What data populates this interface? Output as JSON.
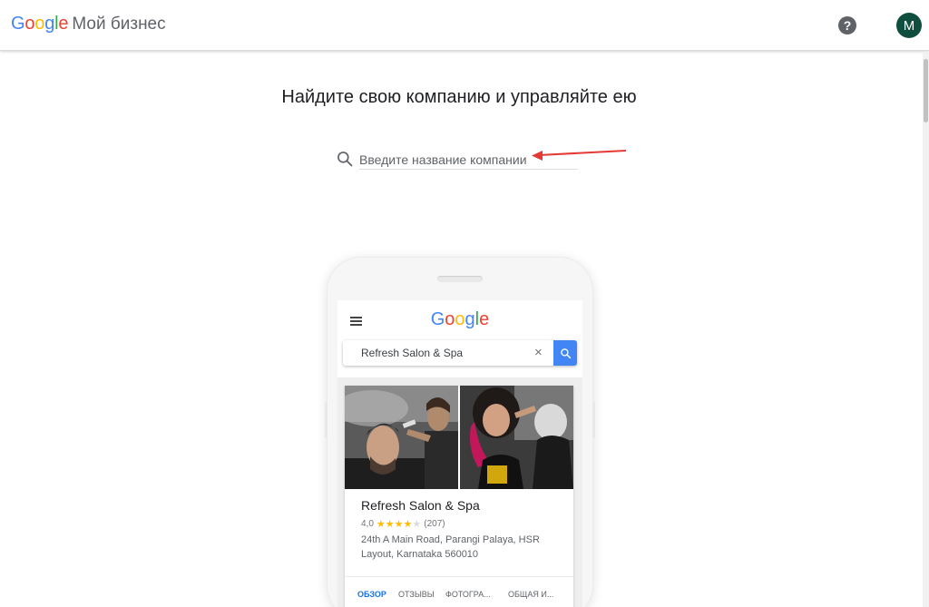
{
  "header": {
    "logo_letters": [
      {
        "ch": "G",
        "color": "#4285F4"
      },
      {
        "ch": "o",
        "color": "#EA4335"
      },
      {
        "ch": "o",
        "color": "#FBBC05"
      },
      {
        "ch": "g",
        "color": "#4285F4"
      },
      {
        "ch": "l",
        "color": "#34A853"
      },
      {
        "ch": "e",
        "color": "#EA4335"
      }
    ],
    "product_name": "Мой бизнес",
    "help_icon": "?",
    "avatar_letter": "M",
    "avatar_color": "#0f4e3f"
  },
  "main": {
    "heading": "Найдите свою компанию и управляйте ею",
    "search": {
      "placeholder": "Введите название компании",
      "value": ""
    },
    "annotation_arrow_color": "#e53935"
  },
  "phone": {
    "logo": "Google",
    "search_query": "Refresh Salon & Spa",
    "clear_symbol": "×",
    "card": {
      "title": "Refresh Salon & Spa",
      "rating_value": "4,0",
      "stars_filled": "★★★★",
      "stars_empty": "★",
      "review_count": "(207)",
      "address": "24th A Main Road, Parangi Palaya, HSR Layout, Karnataka 560010",
      "tabs": [
        "ОБЗОР",
        "ОТЗЫВЫ",
        "ФОТОГРА...",
        "ОБЩАЯ И..."
      ]
    }
  }
}
